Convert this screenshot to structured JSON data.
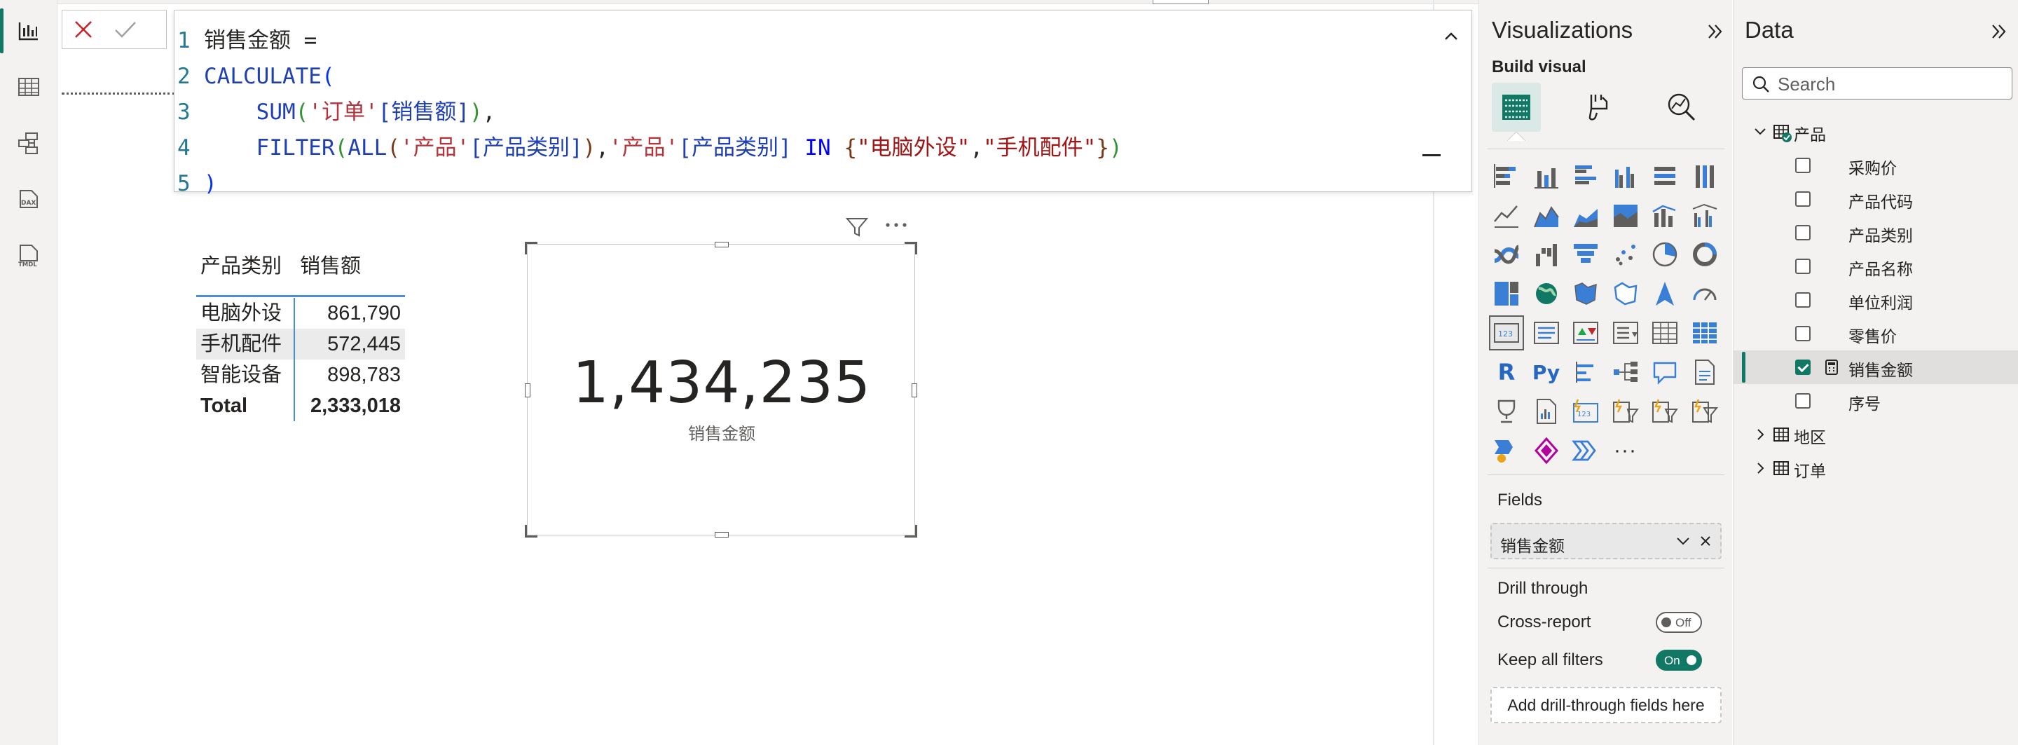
{
  "formula": {
    "lines": [
      {
        "num": "1",
        "parts": [
          [
            "c-id",
            "销售金额 = "
          ]
        ]
      },
      {
        "num": "2",
        "parts": [
          [
            "c-fn",
            "CALCULATE"
          ],
          [
            "c-p1",
            "("
          ]
        ]
      },
      {
        "num": "3",
        "parts": [
          [
            "c-op",
            "    "
          ],
          [
            "c-fn",
            "SUM"
          ],
          [
            "c-p2",
            "("
          ],
          [
            "c-tbl",
            "'订单'"
          ],
          [
            "c-col",
            "[销售额]"
          ],
          [
            "c-p2",
            ")"
          ],
          [
            "c-op",
            ","
          ]
        ]
      },
      {
        "num": "4",
        "parts": [
          [
            "c-op",
            "    "
          ],
          [
            "c-fn",
            "FILTER"
          ],
          [
            "c-p2",
            "("
          ],
          [
            "c-fn",
            "ALL"
          ],
          [
            "c-p3",
            "("
          ],
          [
            "c-tbl",
            "'产品'"
          ],
          [
            "c-col",
            "[产品类别]"
          ],
          [
            "c-p3",
            ")"
          ],
          [
            "c-op",
            ","
          ],
          [
            "c-tbl",
            "'产品'"
          ],
          [
            "c-col",
            "[产品类别]"
          ],
          [
            "c-op",
            " "
          ],
          [
            "c-kw",
            "IN"
          ],
          [
            "c-op",
            " "
          ],
          [
            "c-p3",
            "{"
          ],
          [
            "c-str",
            "\"电脑外设\""
          ],
          [
            "c-op",
            ","
          ],
          [
            "c-str",
            "\"手机配件\""
          ],
          [
            "c-p3",
            "}"
          ],
          [
            "c-p2",
            ")"
          ]
        ]
      },
      {
        "num": "5",
        "parts": [
          [
            "c-p1",
            ")"
          ]
        ]
      }
    ]
  },
  "table_visual": {
    "headers": [
      "产品类别",
      "销售额"
    ],
    "rows": [
      {
        "category": "电脑外设",
        "value": "861,790"
      },
      {
        "category": "手机配件",
        "value": "572,445"
      },
      {
        "category": "智能设备",
        "value": "898,783"
      }
    ],
    "total": {
      "category": "Total",
      "value": "2,333,018"
    }
  },
  "card_visual": {
    "value": "1,434,235",
    "label": "销售金额"
  },
  "visualizations": {
    "title": "Visualizations",
    "build_visual": "Build visual",
    "icons": [
      "stacked-bar-chart",
      "stacked-column-chart",
      "clustered-bar-chart",
      "clustered-column-chart",
      "100-stacked-bar-chart",
      "100-stacked-column-chart",
      "line-chart",
      "area-chart",
      "stacked-area-chart",
      "100-stacked-area-chart",
      "line-and-stacked-column-chart",
      "line-and-clustered-column-chart",
      "ribbon-chart",
      "waterfall-chart",
      "funnel-chart",
      "scatter-chart",
      "pie-chart",
      "donut-chart",
      "treemap",
      "map",
      "filled-map",
      "shape-map",
      "azure-map",
      "gauge",
      "card",
      "multi-row-card",
      "kpi",
      "slicer",
      "table",
      "matrix",
      "r-visual",
      "python-visual",
      "key-influencers",
      "decomposition-tree",
      "qna",
      "paginated-report",
      "metrics",
      "smart-narrative",
      "card-new",
      "slicer-new",
      "slicer-button",
      "slicer-list",
      "power-automate",
      "power-apps",
      "narrative",
      "more-visuals"
    ],
    "r_label": "R",
    "py_label": "Py",
    "more_label": "···",
    "fields_label": "Fields",
    "field_value": "销售金额",
    "drill_through": "Drill through",
    "cross_report": "Cross-report",
    "cross_report_state": "Off",
    "keep_all_filters": "Keep all filters",
    "keep_all_filters_state": "On",
    "drill_well": "Add drill-through fields here"
  },
  "data_pane": {
    "title": "Data",
    "search_placeholder": "Search",
    "tables": [
      {
        "name": "产品",
        "expanded": true,
        "fields": [
          {
            "name": "采购价",
            "checked": false
          },
          {
            "name": "产品代码",
            "checked": false
          },
          {
            "name": "产品类别",
            "checked": false
          },
          {
            "name": "产品名称",
            "checked": false
          },
          {
            "name": "单位利润",
            "checked": false
          },
          {
            "name": "零售价",
            "checked": false
          },
          {
            "name": "销售金额",
            "checked": true,
            "measure": true
          },
          {
            "name": "序号",
            "checked": false
          }
        ]
      },
      {
        "name": "地区",
        "expanded": false
      },
      {
        "name": "订单",
        "expanded": false
      }
    ]
  },
  "colors": {
    "accent": "#117865",
    "table_accent": "#4c8ed6",
    "pane_bg": "#f3f2f1"
  }
}
